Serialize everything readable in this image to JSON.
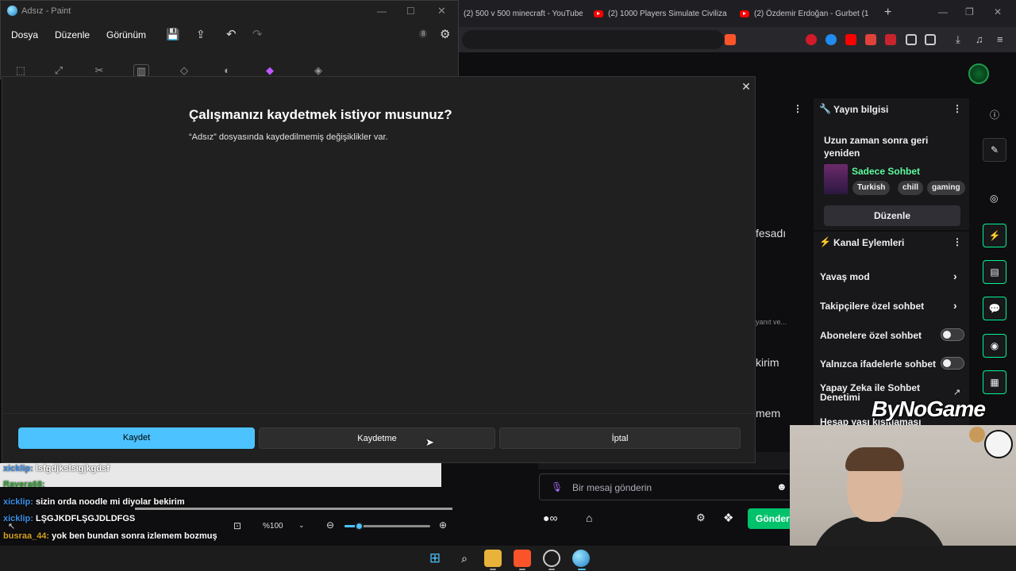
{
  "paint": {
    "title": "Adsız - Paint",
    "menu": [
      "Dosya",
      "Düzenle",
      "Görünüm"
    ],
    "badge_count": "8",
    "zoom": "%100"
  },
  "dialog": {
    "title": "Çalışmanızı kaydetmek istiyor musunuz?",
    "message": "“Adsız” dosyasında kaydedilmemiş değişiklikler var.",
    "save": "Kaydet",
    "dont_save": "Kaydetme",
    "cancel": "İptal"
  },
  "browser": {
    "tabs": [
      "(2) 500 v 500 minecraft - YouTube",
      "(2) 1000 Players Simulate Civiliza",
      "(2) Özdemir Erdoğan - Gurbet (1"
    ]
  },
  "stream_info": {
    "header": "Yayın bilgisi",
    "title": "Uzun zaman sonra geri yeniden",
    "category": "Sadece Sohbet",
    "tags": [
      "Turkish",
      "chill",
      "gaming"
    ],
    "edit": "Düzenle"
  },
  "channel_actions": {
    "header": "Kanal Eylemleri",
    "items": [
      {
        "label": "Yavaş mod",
        "kind": "chevron"
      },
      {
        "label": "Takipçilere özel sohbet",
        "kind": "chevron"
      },
      {
        "label": "Abonelere özel sohbet",
        "kind": "toggle",
        "on": false
      },
      {
        "label": "Yalnızca ifadelerle sohbet",
        "kind": "toggle",
        "on": false
      },
      {
        "label": "Yapay Zeka ile Sohbet Denetimi",
        "kind": "external"
      },
      {
        "label": "Hesap yaşı kısıtlaması",
        "kind": "chevron"
      }
    ]
  },
  "partial_text": {
    "t1": "fesadı",
    "t2": "yanıt ve...",
    "t3": "kirim",
    "t4": "mem"
  },
  "chat": {
    "placeholder": "Bir mesaj gönderin",
    "send": "Gönder",
    "lines": [
      {
        "user": "xicklip:",
        "text": "lsfgdjkslsigjkgdsf"
      },
      {
        "user": "Ravera68:",
        "text": ""
      },
      {
        "user": "xicklip:",
        "text": "sizin orda noodle mi diyolar bekirim"
      },
      {
        "user": "xicklip:",
        "text": "LŞGJKDFLŞGJDLDFGS"
      },
      {
        "user": "busraa_44:",
        "text": "yok ben bundan sonra izlemem bozmuş"
      }
    ]
  },
  "overlay": {
    "brand": "ByNoGame"
  },
  "colors": {
    "accent": "#4cc2ff",
    "twitch_green": "#00f593",
    "category": "#5cfc9c"
  }
}
